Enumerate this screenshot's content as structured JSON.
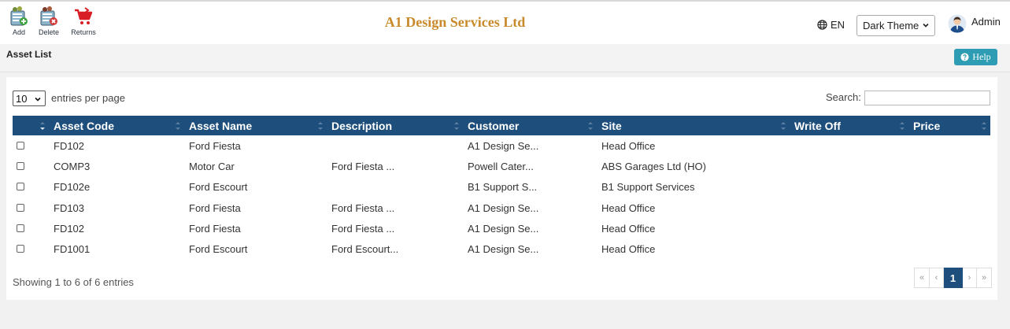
{
  "toolbar": {
    "add_label": "Add",
    "delete_label": "Delete",
    "returns_label": "Returns"
  },
  "header": {
    "company": "A1 Design Services Ltd",
    "language": "EN",
    "theme": "Dark Theme",
    "user": "Admin"
  },
  "page": {
    "title": "Asset List",
    "help_label": "Help"
  },
  "table_controls": {
    "entries_value": "10",
    "entries_label": "entries per page",
    "search_label": "Search:"
  },
  "table": {
    "columns": [
      "Asset Code",
      "Asset Name",
      "Description",
      "Customer",
      "Site",
      "Write Off",
      "Price"
    ],
    "rows": [
      [
        "FD102",
        "Ford Fiesta",
        "",
        "A1 Design Se...",
        "Head Office",
        "",
        ""
      ],
      [
        "COMP3",
        "Motor Car",
        "Ford Fiesta ...",
        "Powell Cater...",
        "ABS Garages Ltd (HO)",
        "",
        ""
      ],
      [
        "FD102e",
        "Ford Escourt",
        "",
        "B1 Support S...",
        "B1 Support Services",
        "",
        ""
      ],
      [
        "FD103",
        "Ford Fiesta",
        "Ford Fiesta ...",
        "A1 Design Se...",
        "Head Office",
        "",
        ""
      ],
      [
        "FD102",
        "Ford Fiesta",
        "Ford Fiesta ...",
        "A1 Design Se...",
        "Head Office",
        "",
        ""
      ],
      [
        "FD1001",
        "Ford Escourt",
        "Ford Escourt...",
        "A1 Design Se...",
        "Head Office",
        "",
        ""
      ]
    ]
  },
  "footer": {
    "info": "Showing 1 to 6 of 6 entries",
    "pager": [
      "«",
      "‹",
      "1",
      "›",
      "»"
    ]
  },
  "colors": {
    "brand": "#c98a2b",
    "table_header": "#1e4f7c",
    "help_button": "#2e9db3"
  }
}
